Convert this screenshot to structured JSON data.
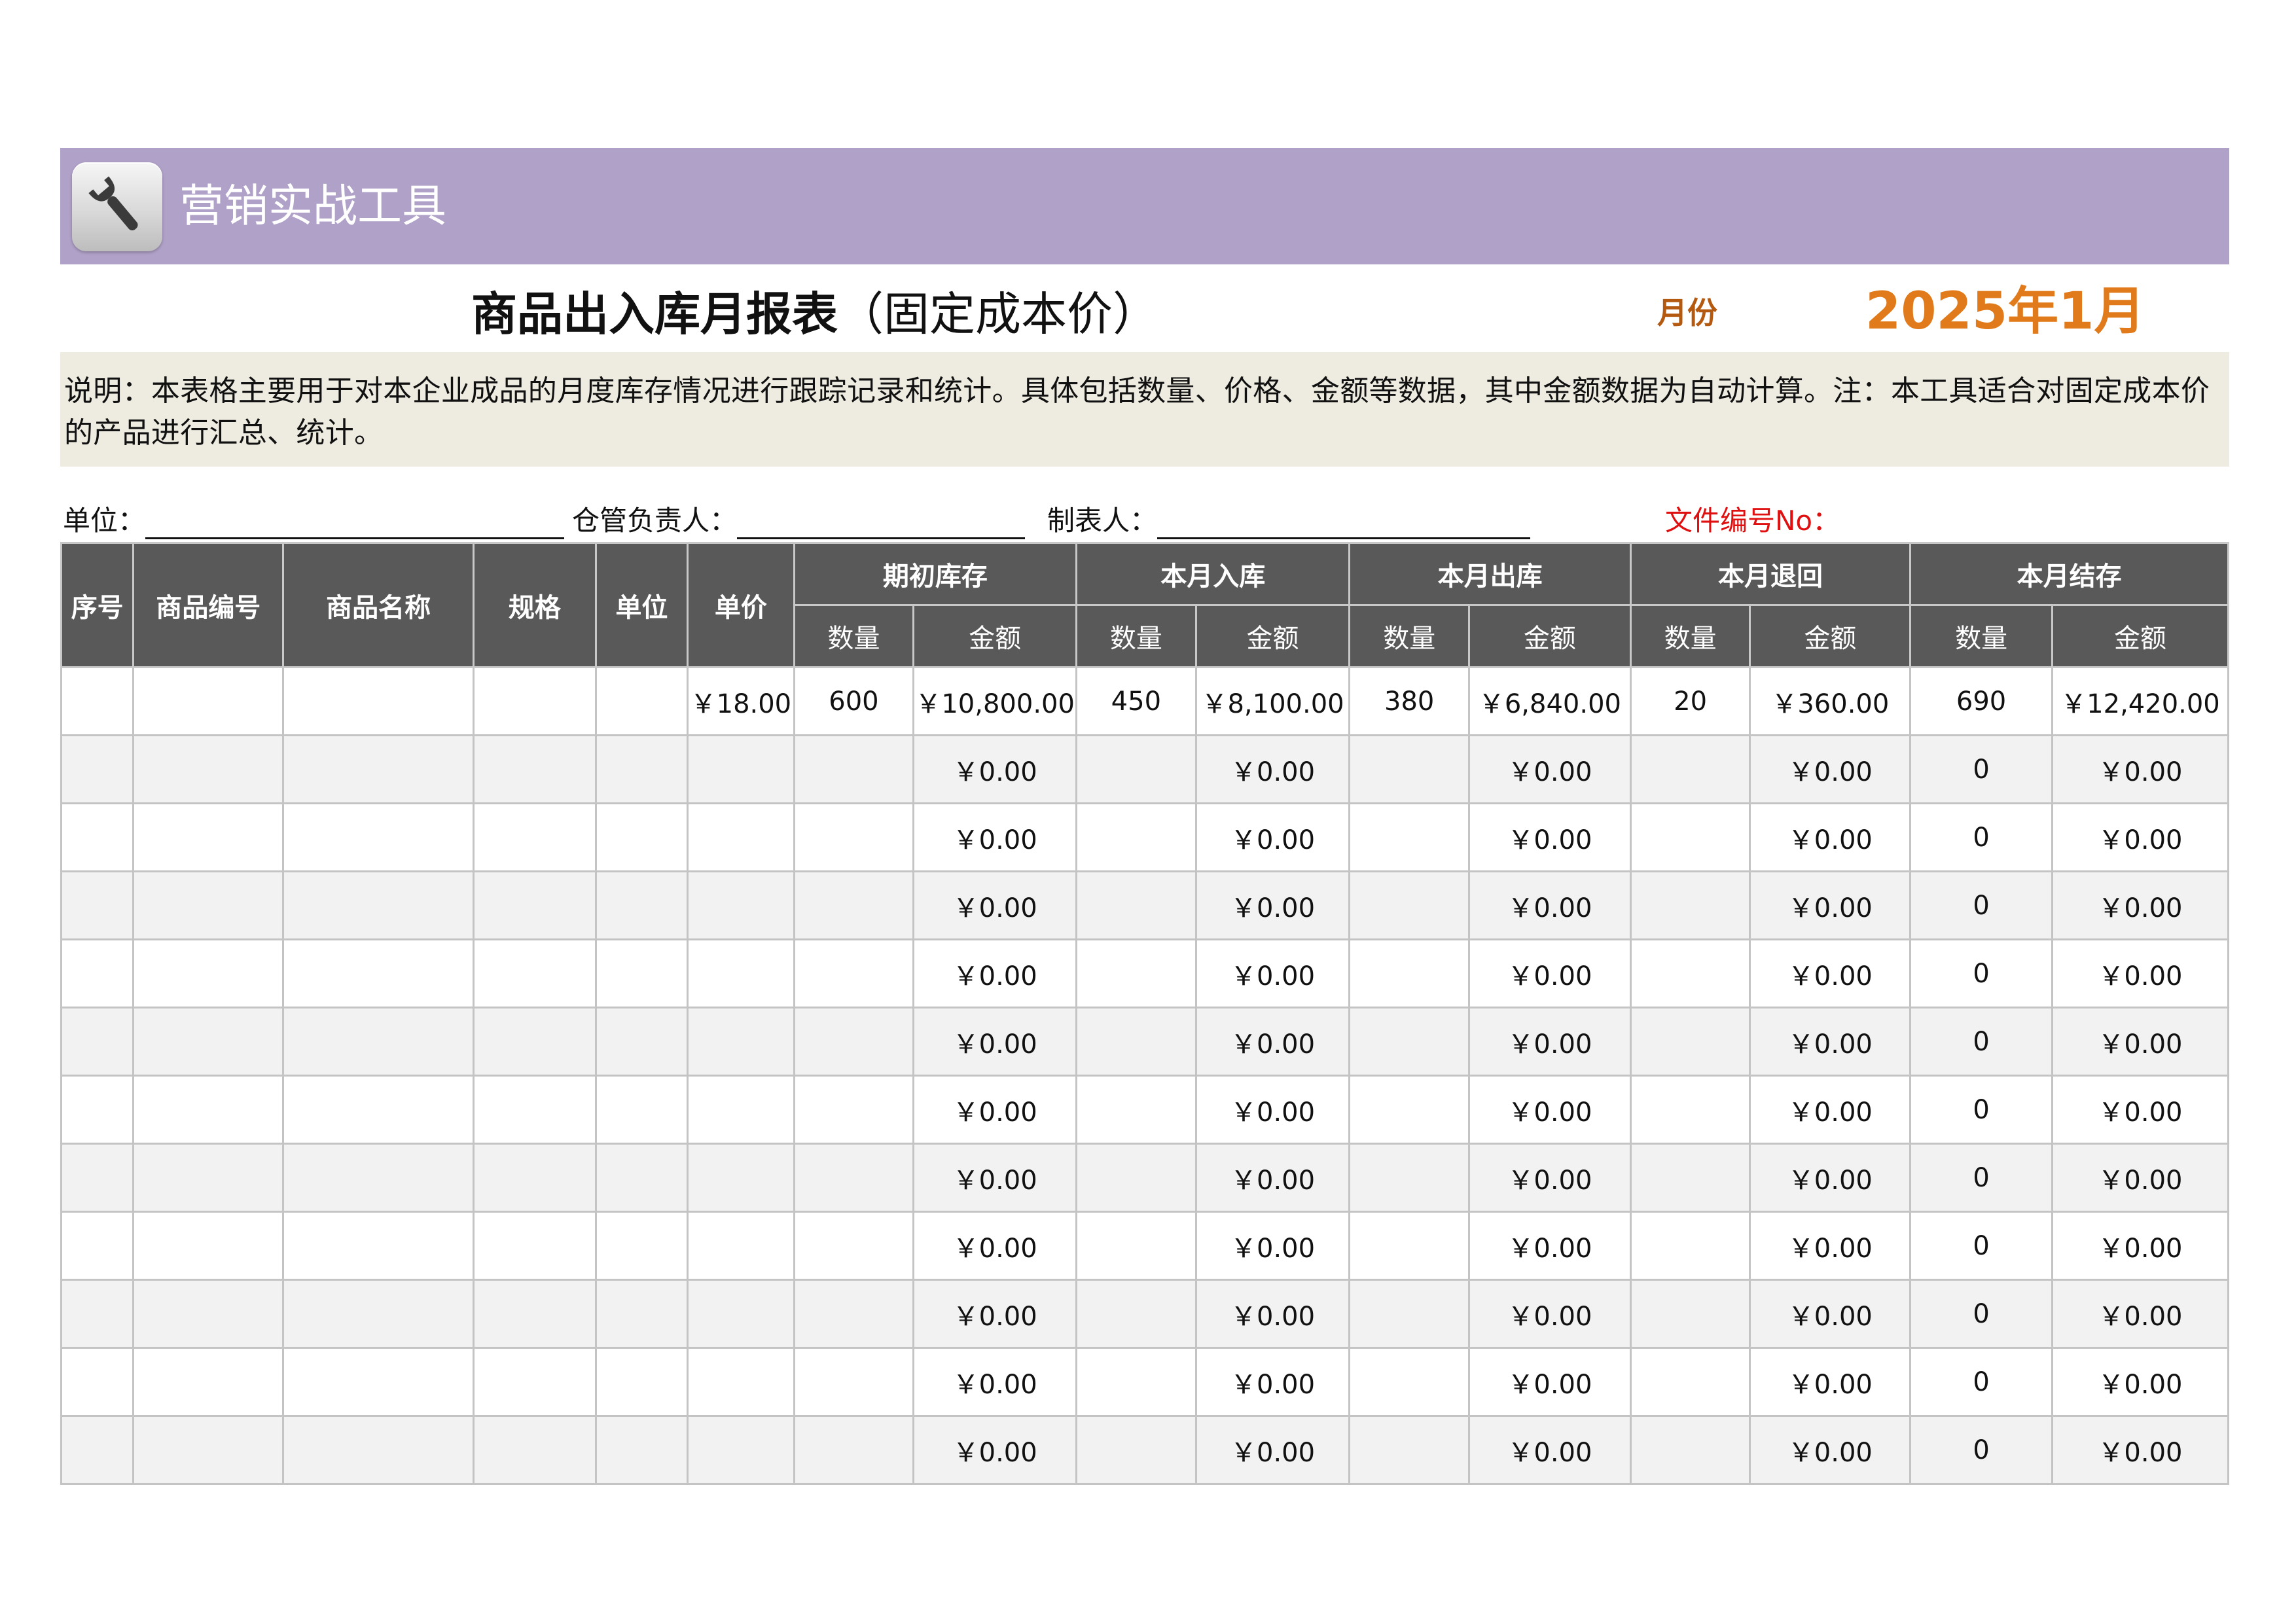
{
  "banner": {
    "title": "营销实战工具",
    "icon": "wrench-icon",
    "color": "#b0a1c8"
  },
  "report": {
    "title_bold": "商品出入库月报表",
    "title_suffix": "（固定成本价）",
    "month_label": "月份",
    "month_value": "2025年1月"
  },
  "note": {
    "text": "说明：本表格主要用于对本企业成品的月度库存情况进行跟踪记录和统计。具体包括数量、价格、金额等数据，其中金额数据为自动计算。注：本工具适合对固定成本价的产品进行汇总、统计。"
  },
  "meta": {
    "unit_label": "单位：",
    "keeper_label": "仓管负责人：",
    "maker_label": "制表人：",
    "file_no_label": "文件编号No："
  },
  "table": {
    "columns": {
      "seq": "序号",
      "code": "商品编号",
      "name": "商品名称",
      "spec": "规格",
      "unit": "单位",
      "price": "单价"
    },
    "groups": {
      "opening": "期初库存",
      "inbound": "本月入库",
      "outbound": "本月出库",
      "returns": "本月退回",
      "closing": "本月结存"
    },
    "sub": {
      "qty": "数量",
      "amount": "金额"
    },
    "rows": [
      {
        "seq": "",
        "code": "",
        "name": "",
        "spec": "",
        "unit": "",
        "price": "￥18.00",
        "open_qty": "600",
        "open_amt": "￥10,800.00",
        "in_qty": "450",
        "in_amt": "￥8,100.00",
        "out_qty": "380",
        "out_amt": "￥6,840.00",
        "ret_qty": "20",
        "ret_amt": "￥360.00",
        "close_qty": "690",
        "close_amt": "￥12,420.00"
      },
      {
        "seq": "",
        "code": "",
        "name": "",
        "spec": "",
        "unit": "",
        "price": "",
        "open_qty": "",
        "open_amt": "￥0.00",
        "in_qty": "",
        "in_amt": "￥0.00",
        "out_qty": "",
        "out_amt": "￥0.00",
        "ret_qty": "",
        "ret_amt": "￥0.00",
        "close_qty": "0",
        "close_amt": "￥0.00"
      },
      {
        "seq": "",
        "code": "",
        "name": "",
        "spec": "",
        "unit": "",
        "price": "",
        "open_qty": "",
        "open_amt": "￥0.00",
        "in_qty": "",
        "in_amt": "￥0.00",
        "out_qty": "",
        "out_amt": "￥0.00",
        "ret_qty": "",
        "ret_amt": "￥0.00",
        "close_qty": "0",
        "close_amt": "￥0.00"
      },
      {
        "seq": "",
        "code": "",
        "name": "",
        "spec": "",
        "unit": "",
        "price": "",
        "open_qty": "",
        "open_amt": "￥0.00",
        "in_qty": "",
        "in_amt": "￥0.00",
        "out_qty": "",
        "out_amt": "￥0.00",
        "ret_qty": "",
        "ret_amt": "￥0.00",
        "close_qty": "0",
        "close_amt": "￥0.00"
      },
      {
        "seq": "",
        "code": "",
        "name": "",
        "spec": "",
        "unit": "",
        "price": "",
        "open_qty": "",
        "open_amt": "￥0.00",
        "in_qty": "",
        "in_amt": "￥0.00",
        "out_qty": "",
        "out_amt": "￥0.00",
        "ret_qty": "",
        "ret_amt": "￥0.00",
        "close_qty": "0",
        "close_amt": "￥0.00"
      },
      {
        "seq": "",
        "code": "",
        "name": "",
        "spec": "",
        "unit": "",
        "price": "",
        "open_qty": "",
        "open_amt": "￥0.00",
        "in_qty": "",
        "in_amt": "￥0.00",
        "out_qty": "",
        "out_amt": "￥0.00",
        "ret_qty": "",
        "ret_amt": "￥0.00",
        "close_qty": "0",
        "close_amt": "￥0.00"
      },
      {
        "seq": "",
        "code": "",
        "name": "",
        "spec": "",
        "unit": "",
        "price": "",
        "open_qty": "",
        "open_amt": "￥0.00",
        "in_qty": "",
        "in_amt": "￥0.00",
        "out_qty": "",
        "out_amt": "￥0.00",
        "ret_qty": "",
        "ret_amt": "￥0.00",
        "close_qty": "0",
        "close_amt": "￥0.00"
      },
      {
        "seq": "",
        "code": "",
        "name": "",
        "spec": "",
        "unit": "",
        "price": "",
        "open_qty": "",
        "open_amt": "￥0.00",
        "in_qty": "",
        "in_amt": "￥0.00",
        "out_qty": "",
        "out_amt": "￥0.00",
        "ret_qty": "",
        "ret_amt": "￥0.00",
        "close_qty": "0",
        "close_amt": "￥0.00"
      },
      {
        "seq": "",
        "code": "",
        "name": "",
        "spec": "",
        "unit": "",
        "price": "",
        "open_qty": "",
        "open_amt": "￥0.00",
        "in_qty": "",
        "in_amt": "￥0.00",
        "out_qty": "",
        "out_amt": "￥0.00",
        "ret_qty": "",
        "ret_amt": "￥0.00",
        "close_qty": "0",
        "close_amt": "￥0.00"
      },
      {
        "seq": "",
        "code": "",
        "name": "",
        "spec": "",
        "unit": "",
        "price": "",
        "open_qty": "",
        "open_amt": "￥0.00",
        "in_qty": "",
        "in_amt": "￥0.00",
        "out_qty": "",
        "out_amt": "￥0.00",
        "ret_qty": "",
        "ret_amt": "￥0.00",
        "close_qty": "0",
        "close_amt": "￥0.00"
      },
      {
        "seq": "",
        "code": "",
        "name": "",
        "spec": "",
        "unit": "",
        "price": "",
        "open_qty": "",
        "open_amt": "￥0.00",
        "in_qty": "",
        "in_amt": "￥0.00",
        "out_qty": "",
        "out_amt": "￥0.00",
        "ret_qty": "",
        "ret_amt": "￥0.00",
        "close_qty": "0",
        "close_amt": "￥0.00"
      },
      {
        "seq": "",
        "code": "",
        "name": "",
        "spec": "",
        "unit": "",
        "price": "",
        "open_qty": "",
        "open_amt": "￥0.00",
        "in_qty": "",
        "in_amt": "￥0.00",
        "out_qty": "",
        "out_amt": "￥0.00",
        "ret_qty": "",
        "ret_amt": "￥0.00",
        "close_qty": "0",
        "close_amt": "￥0.00"
      }
    ]
  }
}
